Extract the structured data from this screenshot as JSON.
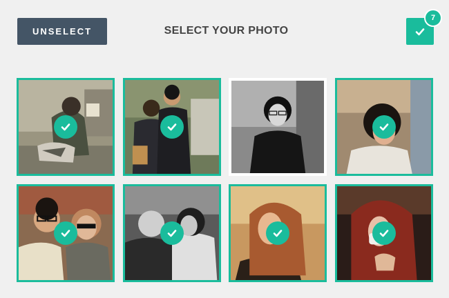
{
  "header": {
    "unselect_label": "UNSELECT",
    "title": "SELECT YOUR PHOTO",
    "selected_count": "7"
  },
  "colors": {
    "accent": "#1abc9c",
    "button_dark": "#445566",
    "background": "#f0f0f0"
  },
  "photos": [
    {
      "name": "photo-woman-sitting-hat",
      "selected": true,
      "style": "color-vintage"
    },
    {
      "name": "photo-two-men-street",
      "selected": true,
      "style": "color-warm"
    },
    {
      "name": "photo-woman-bob-glasses",
      "selected": false,
      "style": "black-and-white"
    },
    {
      "name": "photo-woman-bob-dress",
      "selected": true,
      "style": "color-warm"
    },
    {
      "name": "photo-couple-sunglasses",
      "selected": true,
      "style": "color-warm"
    },
    {
      "name": "photo-two-women-laughing",
      "selected": true,
      "style": "black-and-white"
    },
    {
      "name": "photo-woman-red-hair-laughing",
      "selected": true,
      "style": "color-orange"
    },
    {
      "name": "photo-woman-red-hair-mask",
      "selected": true,
      "style": "color-dark-red"
    }
  ]
}
